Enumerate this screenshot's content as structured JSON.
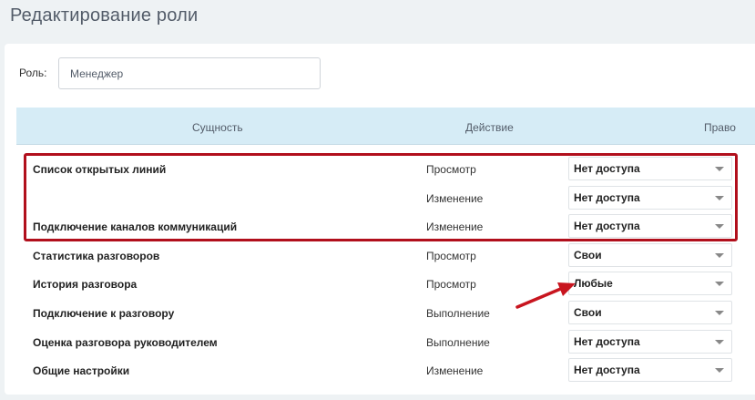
{
  "page": {
    "title": "Редактирование роли"
  },
  "role": {
    "label": "Роль:",
    "value": "Менеджер"
  },
  "table": {
    "headers": {
      "entity": "Сущность",
      "action": "Действие",
      "right": "Право"
    },
    "rows": [
      {
        "entity": "Список открытых линий",
        "action": "Просмотр",
        "right": "Нет доступа"
      },
      {
        "entity": "",
        "action": "Изменение",
        "right": "Нет доступа"
      },
      {
        "entity": "Подключение каналов коммуникаций",
        "action": "Изменение",
        "right": "Нет доступа"
      },
      {
        "entity": "Статистика разговоров",
        "action": "Просмотр",
        "right": "Свои"
      },
      {
        "entity": "История разговора",
        "action": "Просмотр",
        "right": "Любые"
      },
      {
        "entity": "Подключение к разговору",
        "action": "Выполнение",
        "right": "Свои"
      },
      {
        "entity": "Оценка разговора руководителем",
        "action": "Выполнение",
        "right": "Нет доступа"
      },
      {
        "entity": "Общие настройки",
        "action": "Изменение",
        "right": "Нет доступа"
      }
    ]
  },
  "annotations": {
    "highlight_color": "#b10f1c",
    "arrow_color": "#c8151f"
  },
  "icons": {
    "dropdown": "caret-down-icon",
    "pointer": "arrow-annotation-icon"
  }
}
